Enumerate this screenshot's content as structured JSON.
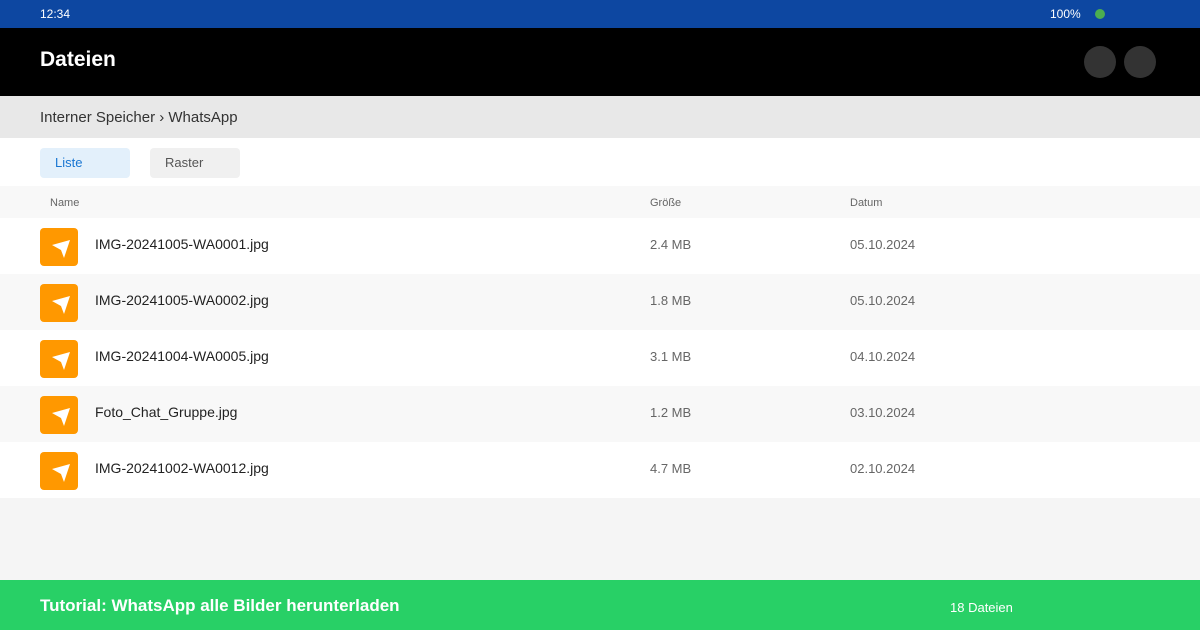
{
  "status_bar": {
    "time": "12:34",
    "battery": "100%",
    "indicator_color": "#4caf50"
  },
  "app_bar": {
    "title": "Dateien"
  },
  "breadcrumb": "Interner Speicher › WhatsApp",
  "view_toggle": {
    "list_label": "Liste",
    "grid_label": "Raster",
    "selected": "Liste"
  },
  "columns": {
    "name": "Name",
    "size": "Größe",
    "date": "Datum"
  },
  "files": [
    {
      "name": "IMG-20241005-WA0001.jpg",
      "size": "2.4 MB",
      "date": "05.10.2024",
      "icon": "image-file-icon"
    },
    {
      "name": "IMG-20241005-WA0002.jpg",
      "size": "1.8 MB",
      "date": "05.10.2024",
      "icon": "image-file-icon"
    },
    {
      "name": "IMG-20241004-WA0005.jpg",
      "size": "3.1 MB",
      "date": "04.10.2024",
      "icon": "image-file-icon"
    },
    {
      "name": "Foto_Chat_Gruppe.jpg",
      "size": "1.2 MB",
      "date": "03.10.2024",
      "icon": "image-file-icon"
    },
    {
      "name": "IMG-20241002-WA0012.jpg",
      "size": "4.7 MB",
      "date": "02.10.2024",
      "icon": "image-file-icon"
    }
  ],
  "footer": {
    "title": "Tutorial: WhatsApp alle Bilder herunterladen",
    "count": "18 Dateien"
  },
  "colors": {
    "status_bar": "#0d47a1",
    "app_bar": "#000000",
    "file_icon": "#ff9800",
    "footer": "#28d066",
    "active_toggle": "#1976d2"
  }
}
